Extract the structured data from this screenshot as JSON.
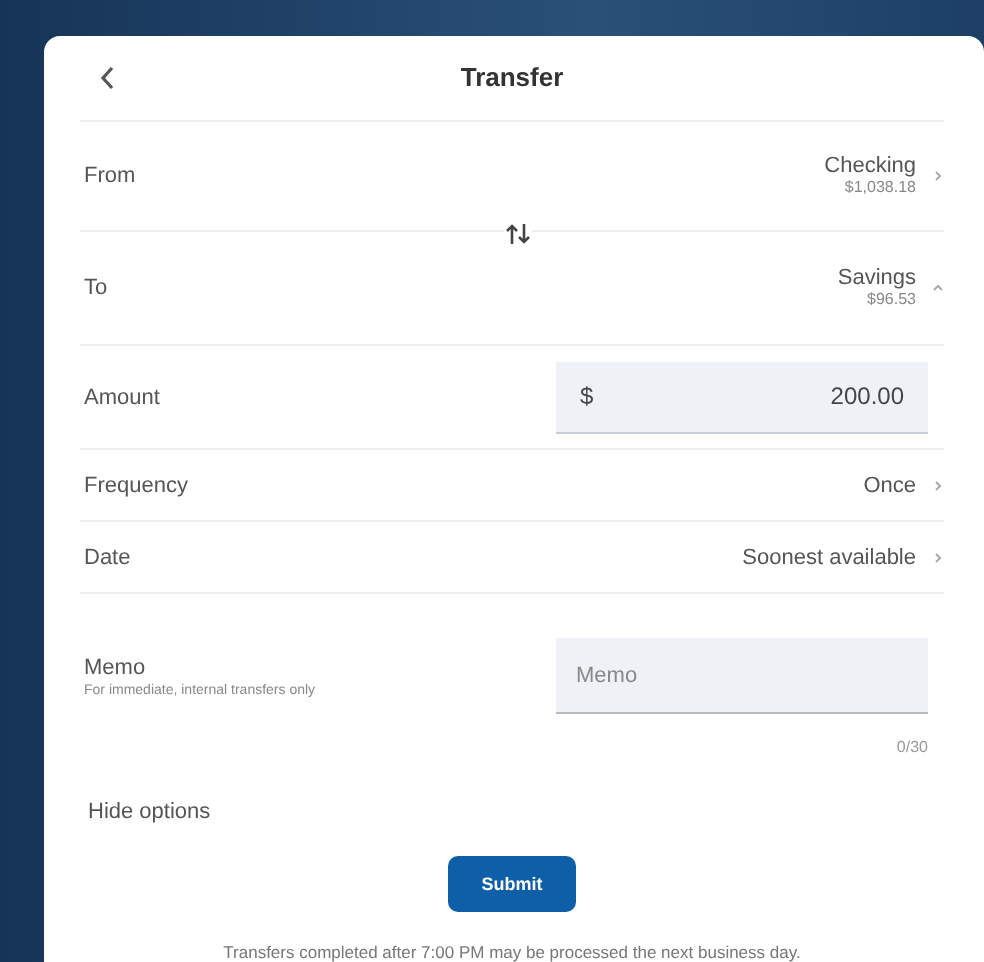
{
  "header": {
    "title": "Transfer"
  },
  "accounts": [
    {
      "label": "From",
      "name": "Checking",
      "balance": "$1,038.18"
    },
    {
      "label": "To",
      "name": "Savings",
      "balance": "$96.53"
    }
  ],
  "amount": {
    "label": "Amount",
    "currency": "$",
    "value": "200.00"
  },
  "options": [
    {
      "label": "Frequency",
      "value": "Once"
    },
    {
      "label": "Date",
      "value": "Soonest available"
    }
  ],
  "memo": {
    "label": "Memo",
    "hint": "For immediate, internal transfers only",
    "placeholder": "Memo",
    "counter": "0/30"
  },
  "toggle": "Hide options",
  "submit": "Submit",
  "footnote": "Transfers completed after 7:00 PM may be processed the next business day."
}
